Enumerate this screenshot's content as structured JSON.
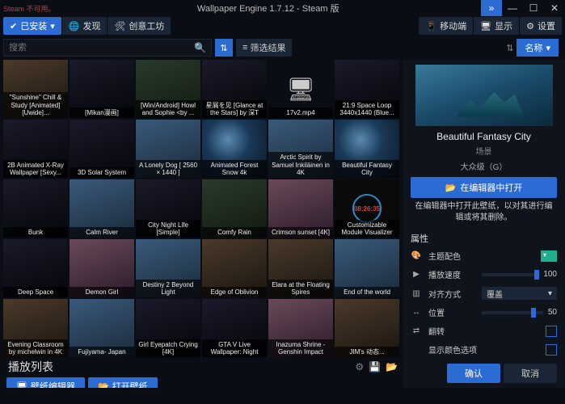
{
  "titlebar": {
    "status": "Steam 不可用。",
    "title": "Wallpaper Engine 1.7.12  -  Steam 版"
  },
  "tabs": {
    "installed": "已安装",
    "discover": "发现",
    "workshop": "创意工坊",
    "mobile": "移动端",
    "display": "显示",
    "settings": "设置"
  },
  "search": {
    "placeholder": "搜索"
  },
  "filter": {
    "label": "筛选结果"
  },
  "sort": {
    "label": "名称"
  },
  "thumbs": [
    [
      "\"Sunshine\" Chill & Study [Animated][Uwide]...",
      "[Mikan漫画]",
      "[Win/Android] Howl and Sophie <by ...",
      "星屑を见 [Glance at the Stars] by 深T",
      "17v2.mp4",
      "21:9 Space Loop 3440x1440 (Blue..."
    ],
    [
      "2B Animated X-Ray Wallpaper [Sexy...",
      "3D Solar System",
      "A Lonely Dog [ 2560 × 1440 ]",
      "Animated Forest Snow 4k",
      "Arctic Spirit by Samuel Inkiläinen in 4K",
      "Beautiful Fantasy City"
    ],
    [
      "Bunk",
      "Calm River",
      "City Night Life [Simple]",
      "Comfy Rain",
      "Crimson sunset [4K]",
      "Customizable Module Visualizer"
    ],
    [
      "Deep Space",
      "Demon Girl",
      "Destiny 2 Beyond Light",
      "Edge of Oblivion",
      "Elara at the Floating Spires",
      "End of the world"
    ],
    [
      "Evening Classroom by michelwin in 4K",
      "Fujiyama- Japan",
      "Girl Eyepatch Crying [4K]",
      "GTA V Live Wallpaper: Night",
      "Inazuma Shrine - Genshin Impact",
      "JIM's 动态..."
    ]
  ],
  "thumbBg": [
    [
      "bg2",
      "bg4",
      "bg3",
      "bg4",
      "bg7",
      "bg4"
    ],
    [
      "bg4",
      "bg4",
      "bg1",
      "bg5",
      "bg1",
      "bg5"
    ],
    [
      "bg4",
      "bg1",
      "bg4",
      "bg3",
      "bg6",
      "bgclock"
    ],
    [
      "bg4",
      "bg6",
      "bg1",
      "bg2",
      "bg2",
      "bg1"
    ],
    [
      "bg2",
      "bg1",
      "bg4",
      "bg4",
      "bg6",
      "bg2"
    ]
  ],
  "playlist": {
    "title": "播放列表"
  },
  "bottom": {
    "editor": "壁纸编辑器",
    "open": "打开壁纸"
  },
  "side": {
    "title": "Beautiful Fantasy City",
    "type": "场景",
    "rating": "大众级（G）",
    "openInEditor": "在编辑器中打开",
    "openDesc": "在编辑器中打开此壁纸，以对其进行编辑或将其删除。",
    "propsTitle": "属性",
    "props": {
      "color": "主题配色",
      "speed": "播放速度",
      "speedVal": "100",
      "align": "对齐方式",
      "alignVal": "覆盖",
      "pos": "位置",
      "posVal": "50",
      "flip": "翻转",
      "showColor": "显示颜色选项"
    }
  },
  "footer": {
    "ok": "确认",
    "cancel": "取消"
  }
}
